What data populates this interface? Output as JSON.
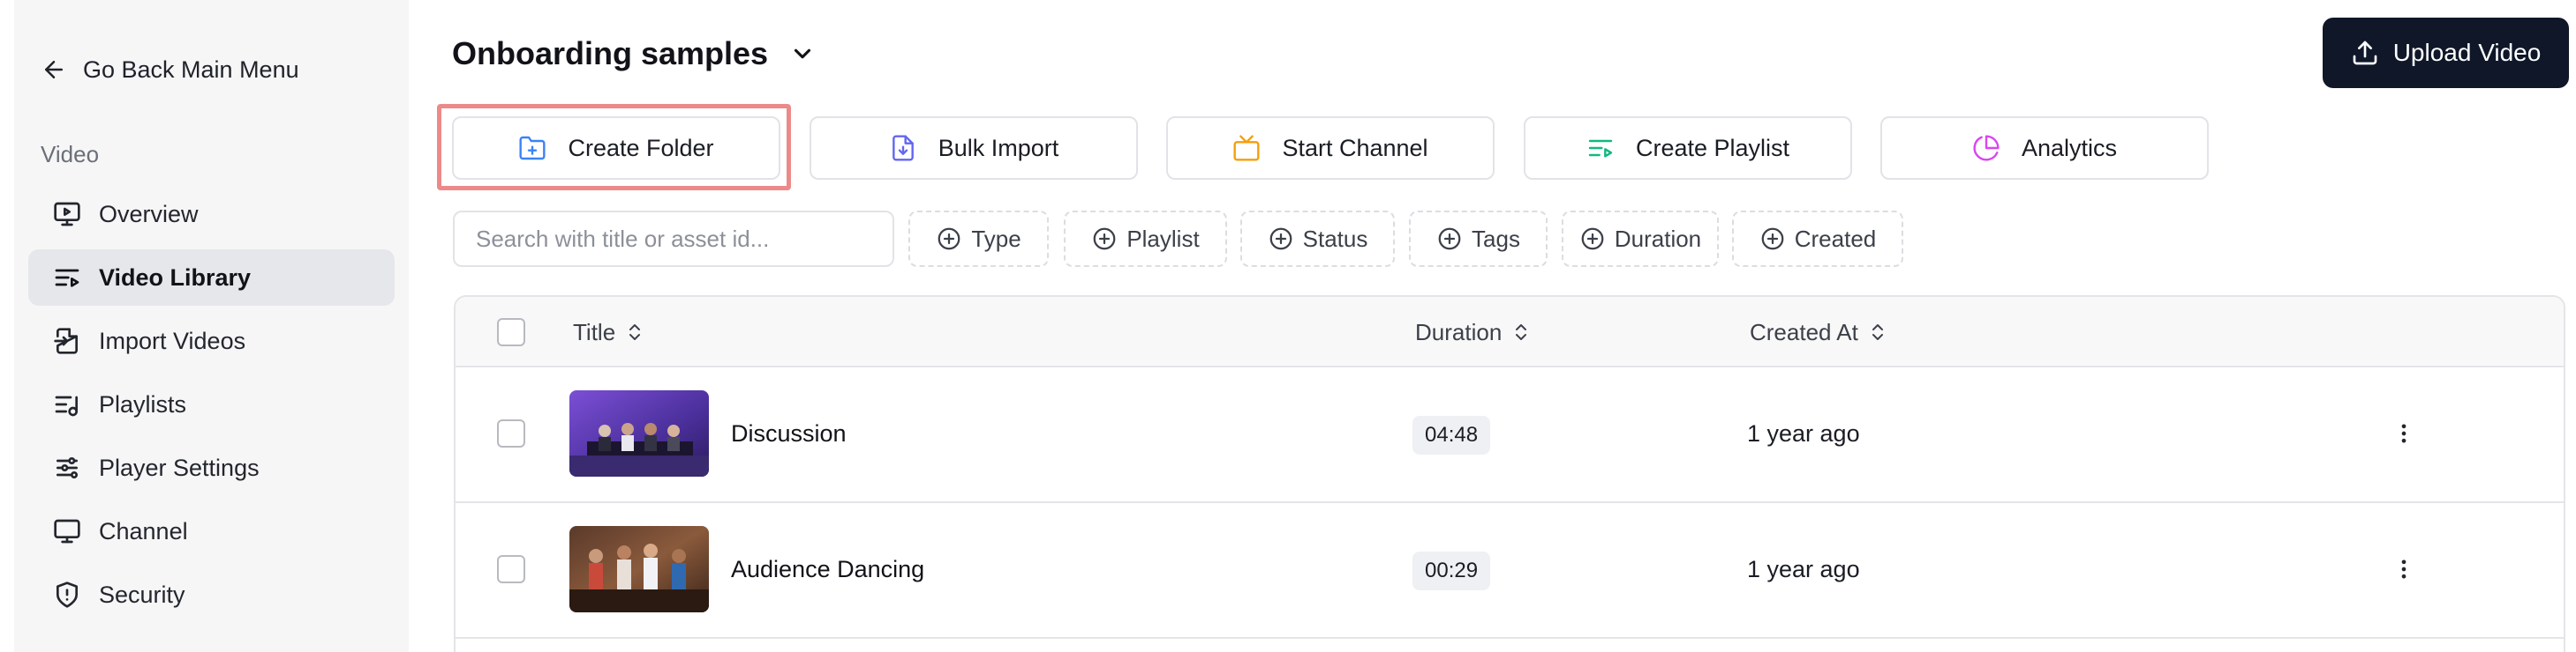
{
  "sidebar": {
    "back_label": "Go Back Main Menu",
    "section_label": "Video",
    "items": [
      {
        "label": "Overview",
        "icon": "monitor-play-icon",
        "active": false
      },
      {
        "label": "Video Library",
        "icon": "list-video-icon",
        "active": true
      },
      {
        "label": "Import Videos",
        "icon": "file-import-icon",
        "active": false
      },
      {
        "label": "Playlists",
        "icon": "list-music-icon",
        "active": false
      },
      {
        "label": "Player Settings",
        "icon": "sliders-icon",
        "active": false
      },
      {
        "label": "Channel",
        "icon": "monitor-icon",
        "active": false
      },
      {
        "label": "Security",
        "icon": "shield-icon",
        "active": false
      }
    ]
  },
  "header": {
    "title": "Onboarding samples",
    "upload_label": "Upload Video"
  },
  "actions": [
    {
      "label": "Create Folder",
      "icon": "folder-plus-icon",
      "color": "#3b82f6"
    },
    {
      "label": "Bulk Import",
      "icon": "file-download-icon",
      "color": "#6366f1"
    },
    {
      "label": "Start Channel",
      "icon": "tv-icon",
      "color": "#f59e0b"
    },
    {
      "label": "Create Playlist",
      "icon": "list-video-icon",
      "color": "#10b981"
    },
    {
      "label": "Analytics",
      "icon": "pie-chart-icon",
      "color": "#d946ef"
    }
  ],
  "search": {
    "placeholder": "Search with title or asset id...",
    "value": ""
  },
  "filters": [
    "Type",
    "Playlist",
    "Status",
    "Tags",
    "Duration",
    "Created"
  ],
  "table": {
    "columns": {
      "title": "Title",
      "duration": "Duration",
      "created": "Created At"
    },
    "rows": [
      {
        "title": "Discussion",
        "duration": "04:48",
        "created": "1 year ago"
      },
      {
        "title": "Audience Dancing",
        "duration": "00:29",
        "created": "1 year ago"
      }
    ]
  },
  "colors": {
    "primary_button": "#0f1729",
    "highlight_border": "#ec8a8a",
    "sidebar_bg": "#f6f6f7",
    "active_item_bg": "#e6e7ea"
  }
}
